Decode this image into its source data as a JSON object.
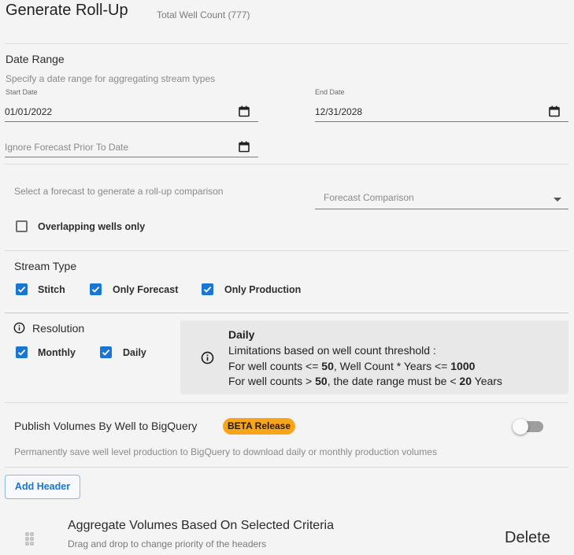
{
  "header": {
    "title": "Generate Roll-Up",
    "well_count": "Total Well Count (777)"
  },
  "date_range": {
    "heading": "Date Range",
    "hint": "Specify a date range for aggregating stream types",
    "start_label": "Start Date",
    "start_value": "01/01/2022",
    "end_label": "End Date",
    "end_value": "12/31/2028",
    "ignore_placeholder": "Ignore Forecast Prior To Date"
  },
  "forecast": {
    "hint": "Select a forecast to generate a roll-up comparison",
    "select_placeholder": "Forecast Comparison",
    "overlap_label": "Overlapping wells only",
    "overlap_checked": false
  },
  "stream_type": {
    "heading": "Stream Type",
    "options": [
      {
        "label": "Stitch",
        "checked": true
      },
      {
        "label": "Only Forecast",
        "checked": true
      },
      {
        "label": "Only Production",
        "checked": true
      }
    ]
  },
  "resolution": {
    "heading": "Resolution",
    "options": [
      {
        "label": "Monthly",
        "checked": true
      },
      {
        "label": "Daily",
        "checked": true
      }
    ],
    "info": {
      "title": "Daily",
      "line1": "Limitations based on well count threshold :",
      "line2_pre": "For well counts <= ",
      "line2_n1": "50",
      "line2_mid": ", Well Count * Years <= ",
      "line2_n2": "1000",
      "line3_pre": "For well counts > ",
      "line3_n1": "50",
      "line3_mid": ", the date range must be < ",
      "line3_n2": "20",
      "line3_post": " Years"
    }
  },
  "publish": {
    "label": "Publish Volumes By Well to BigQuery",
    "badge": "BETA Release",
    "hint": "Permanently save well level production to BigQuery to download daily or monthly production volumes",
    "enabled": false
  },
  "add_header_label": "Add Header",
  "aggregate": {
    "title": "Aggregate Volumes Based On Selected Criteria",
    "subtitle": "Drag and drop to change priority of the headers",
    "delete_label": "Delete"
  },
  "colors": {
    "accent": "#1976d2",
    "badge": "#f8a519",
    "info_bg": "#e8e8e8"
  }
}
